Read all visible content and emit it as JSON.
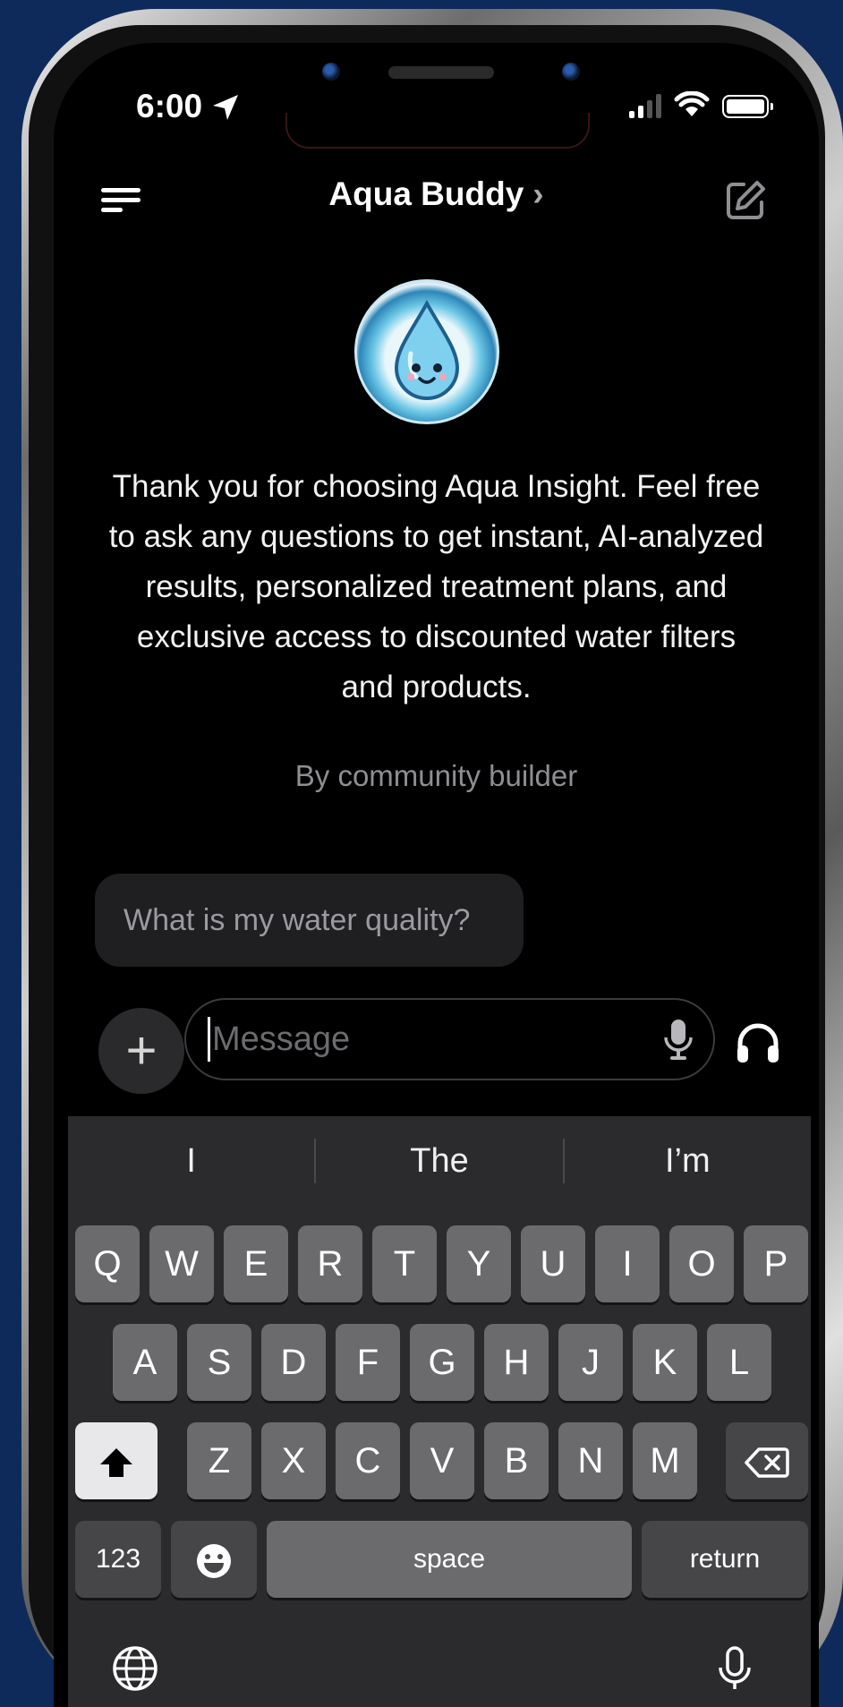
{
  "status_bar": {
    "time": "6:00",
    "signal_bars": 4,
    "signal_active": 2
  },
  "header": {
    "title": "Aqua Buddy",
    "chevron": "›"
  },
  "intro": {
    "message": "Thank you for choosing Aqua Insight. Feel free to ask any questions to get instant, AI-analyzed results, personalized treatment plans, and exclusive access to discounted water filters and products.",
    "byline": "By community builder"
  },
  "suggestion": "What is my water quality?",
  "composer": {
    "placeholder": "Message"
  },
  "keyboard": {
    "predictions": [
      "I",
      "The",
      "I’m"
    ],
    "row1": [
      "Q",
      "W",
      "E",
      "R",
      "T",
      "Y",
      "U",
      "I",
      "O",
      "P"
    ],
    "row2": [
      "A",
      "S",
      "D",
      "F",
      "G",
      "H",
      "J",
      "K",
      "L"
    ],
    "row3": [
      "Z",
      "X",
      "C",
      "V",
      "B",
      "N",
      "M"
    ],
    "numbers_key": "123",
    "space_key": "space",
    "return_key": "return"
  },
  "icons": [
    "menu-icon",
    "compose-icon",
    "location-arrow-icon",
    "wifi-icon",
    "battery-icon",
    "mic-icon",
    "headphones-icon",
    "shift-icon",
    "delete-icon",
    "emoji-icon",
    "globe-icon",
    "dictation-mic-icon",
    "plus-icon"
  ],
  "colors": {
    "background": "#0d2a5a",
    "screen": "#000000",
    "keyboard": "#2b2b2d",
    "key": "#6b6b6e"
  }
}
